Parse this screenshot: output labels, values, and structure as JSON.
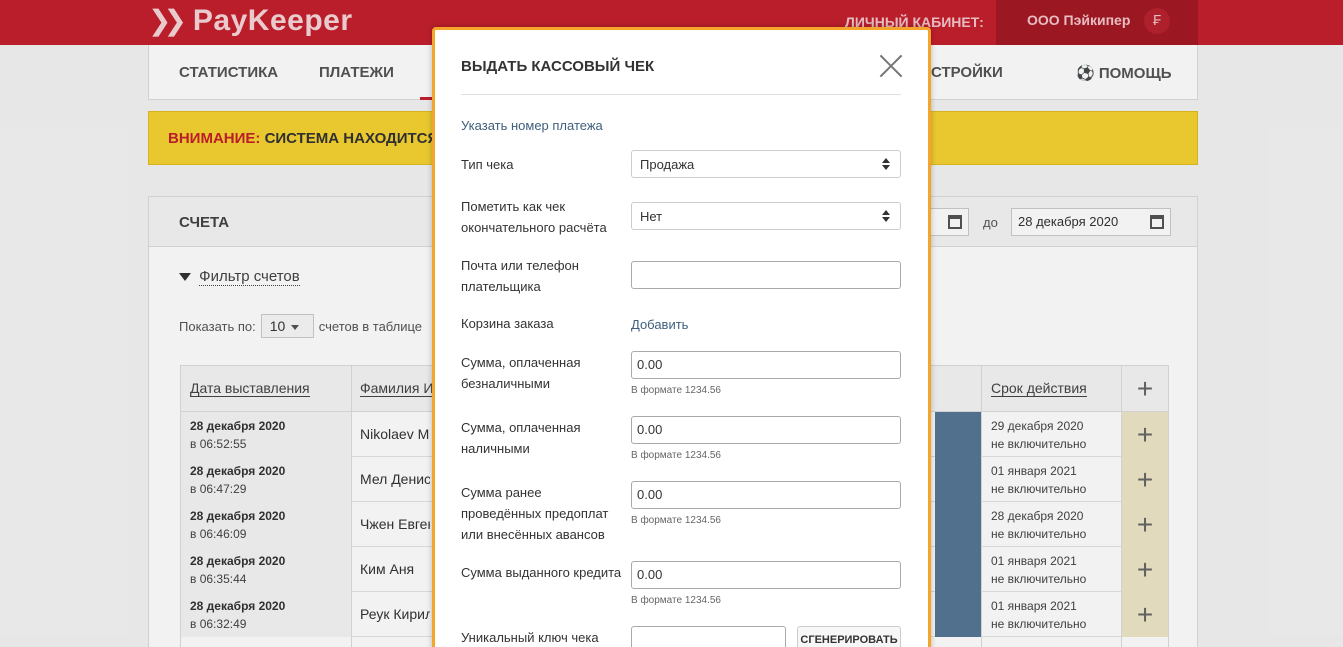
{
  "header": {
    "logo_text": "PayKeeper",
    "cabinet_label": "ЛИЧНЫЙ КАБИНЕТ:",
    "user_name": "ООО Пэйкипер"
  },
  "nav": {
    "items": [
      "СТАТИСТИКА",
      "ПЛАТЕЖИ",
      "СТРОЙКИ",
      "ПОМОЩЬ"
    ]
  },
  "warning": {
    "label": "ВНИМАНИЕ:",
    "text": "СИСТЕМА НАХОДИТСЯ В"
  },
  "invoices": {
    "title": "СЧЕТА",
    "date_to_label": "до",
    "date_to_value": "28 декабря 2020",
    "filter_label": "Фильтр счетов",
    "show_label": "Показать по:",
    "per_page": "10",
    "per_page_suffix": "счетов в таблице",
    "columns": [
      "Дата выставления",
      "Фамилия Им",
      "Срок действия"
    ],
    "rows": [
      {
        "date": "28 декабря 2020",
        "time": "в 06:52:55",
        "name": "Nikolaev Mik",
        "expiry": "29 декабря 2020",
        "expiry_note": "не включительно"
      },
      {
        "date": "28 декабря 2020",
        "time": "в 06:47:29",
        "name": "Мел Денис",
        "expiry": "01 января 2021",
        "expiry_note": "не включительно"
      },
      {
        "date": "28 декабря 2020",
        "time": "в 06:46:09",
        "name": "Чжен Евгени",
        "expiry": "28 декабря 2020",
        "expiry_note": "не включительно"
      },
      {
        "date": "28 декабря 2020",
        "time": "в 06:35:44",
        "name": "Ким Аня",
        "expiry": "01 января 2021",
        "expiry_note": "не включительно"
      },
      {
        "date": "28 декабря 2020",
        "time": "в 06:32:49",
        "name": "Реук Кирилл",
        "expiry": "01 января 2021",
        "expiry_note": "не включительно"
      }
    ]
  },
  "modal": {
    "title": "ВЫДАТЬ КАССОВЫЙ ЧЕК",
    "payment_link": "Указать номер платежа",
    "receipt_type_label": "Тип чека",
    "receipt_type_value": "Продажа",
    "final_label": "Пометить как чек окончательного расчёта",
    "final_value": "Нет",
    "contact_label": "Почта или телефон плательщика",
    "contact_value": "",
    "cart_label": "Корзина заказа",
    "cart_link": "Добавить",
    "cashless_label": "Сумма, оплаченная безналичными",
    "cashless_value": "0.00",
    "cash_label": "Сумма, оплаченная наличными",
    "cash_value": "0.00",
    "prepay_label": "Сумма ранее проведённых предоплат или внесённых авансов",
    "prepay_value": "0.00",
    "credit_label": "Сумма выданного кредита",
    "credit_value": "0.00",
    "format_hint": "В формате 1234.56",
    "unique_key_label": "Уникальный ключ чека",
    "unique_key_value": "",
    "generate_button": "СГЕНЕРИРОВАТЬ"
  }
}
